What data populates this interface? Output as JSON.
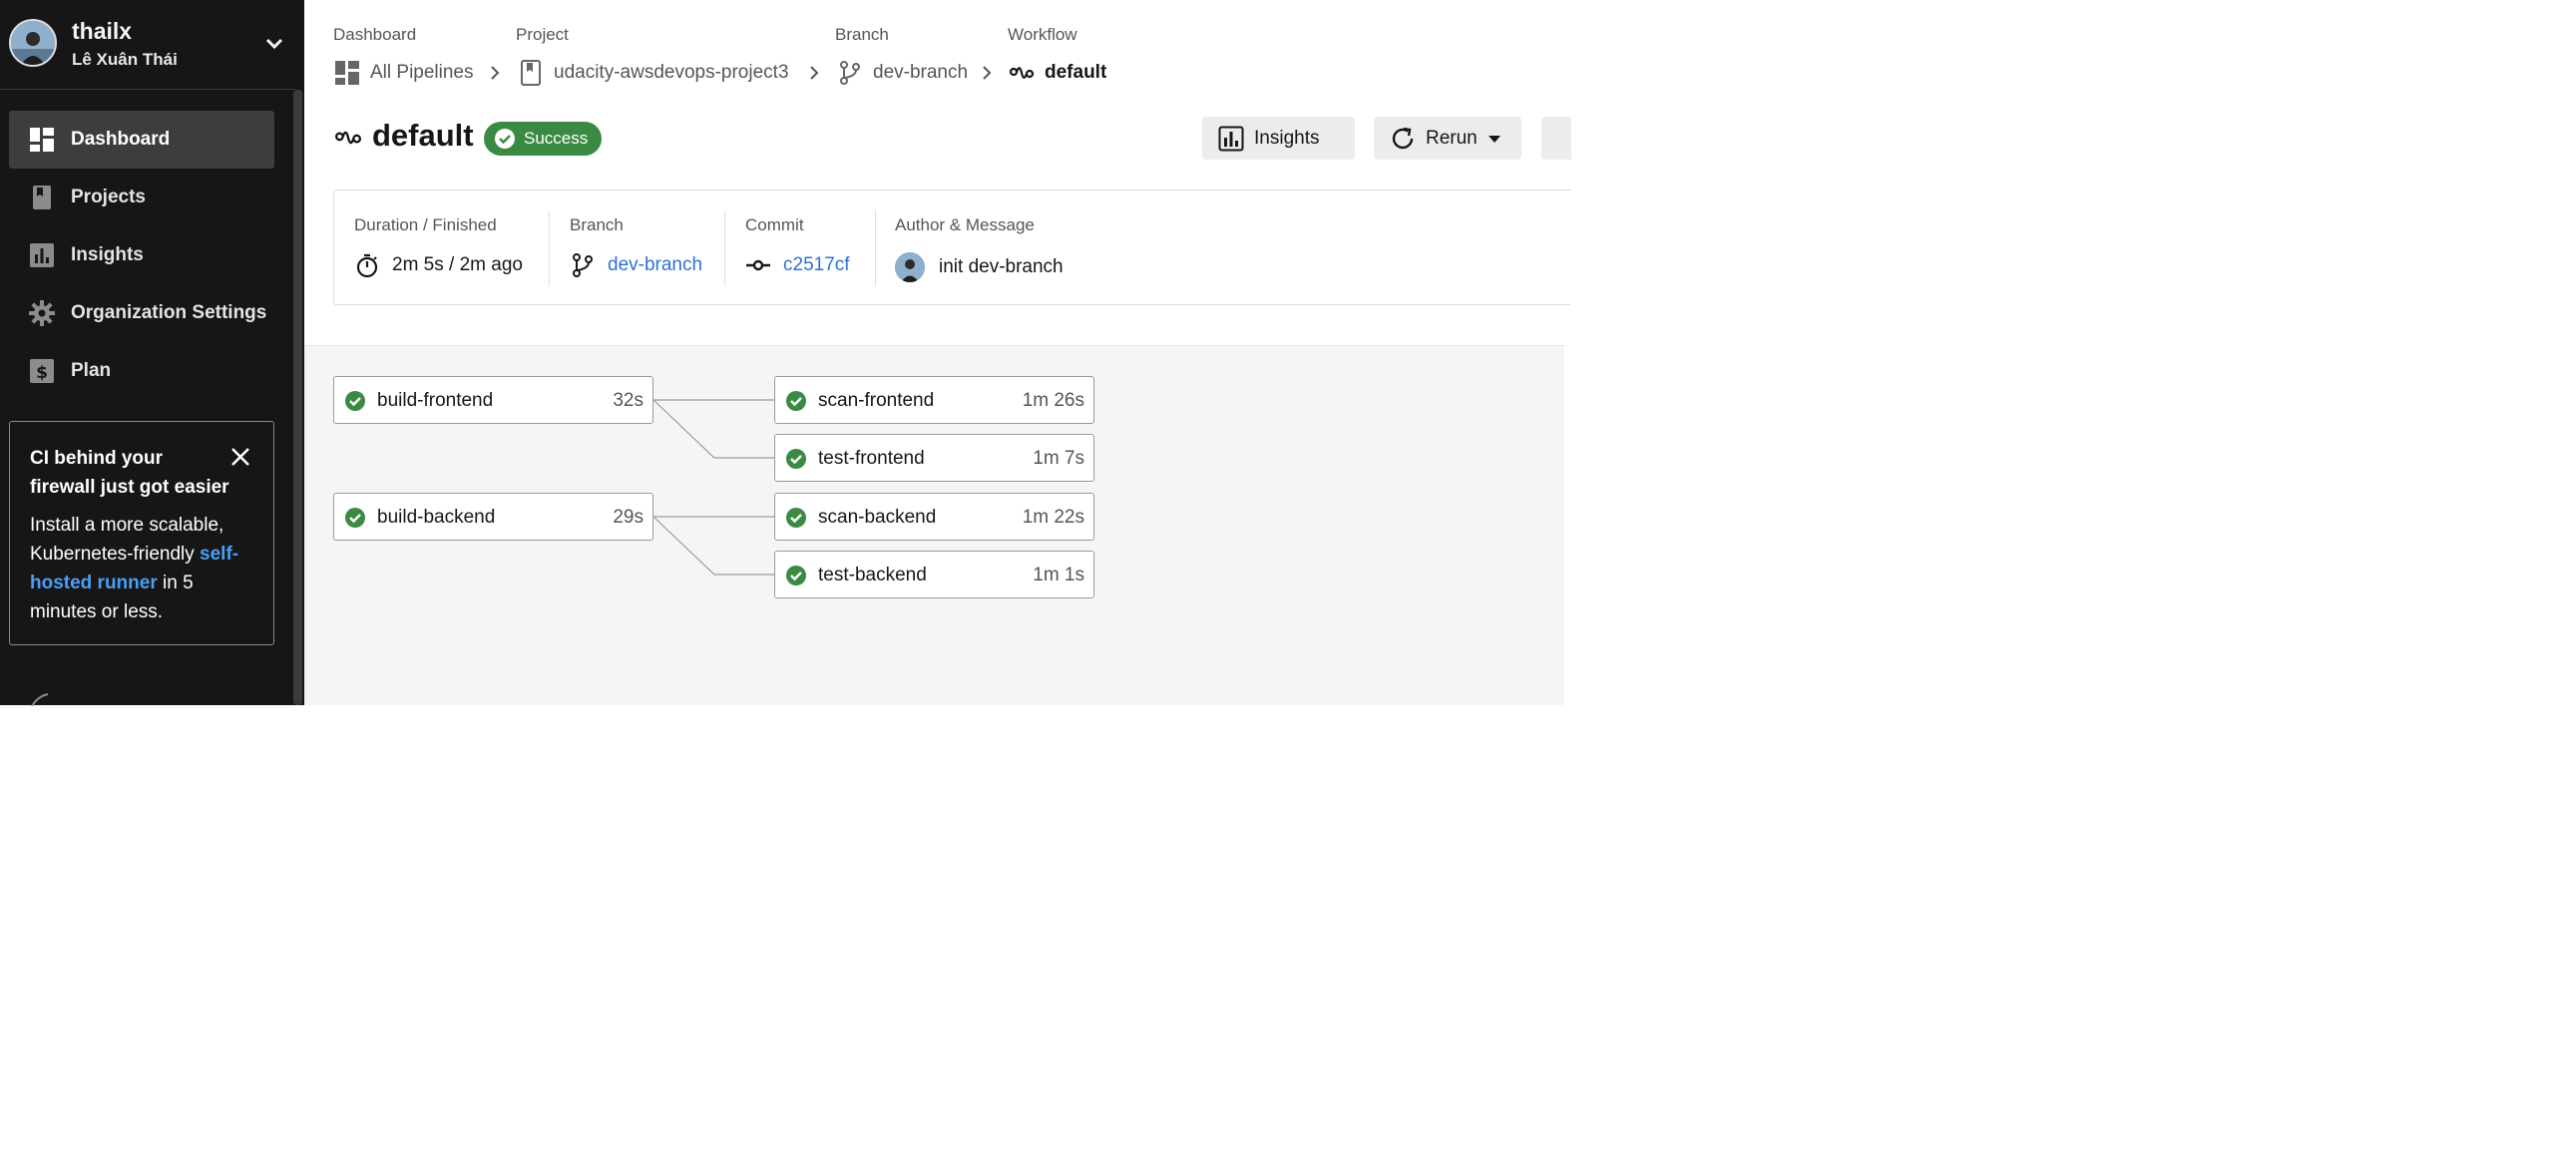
{
  "user": {
    "username": "thailx",
    "full_name": "Lê Xuân Thái"
  },
  "sidebar": {
    "items": [
      {
        "label": "Dashboard",
        "icon": "dashboard-icon",
        "active": true
      },
      {
        "label": "Projects",
        "icon": "projects-icon",
        "active": false
      },
      {
        "label": "Insights",
        "icon": "insights-icon",
        "active": false
      },
      {
        "label": "Organization Settings",
        "icon": "gear-icon",
        "active": false
      },
      {
        "label": "Plan",
        "icon": "dollar-icon",
        "active": false
      }
    ],
    "promo": {
      "title": "CI behind your firewall just got easier",
      "body_before": "Install a more scalable, Kubernetes-friendly ",
      "link": "self-hosted runner",
      "body_after": " in 5 minutes or less."
    }
  },
  "breadcrumb": {
    "labels": [
      "Dashboard",
      "Project",
      "Branch",
      "Workflow"
    ],
    "values": [
      "All Pipelines",
      "udacity-awsdevops-project3",
      "dev-branch",
      "default"
    ]
  },
  "workflow": {
    "name": "default",
    "status": "Success",
    "buttons": {
      "insights": "Insights",
      "rerun": "Rerun"
    }
  },
  "meta": {
    "duration_label": "Duration / Finished",
    "duration_value": "2m 5s / 2m ago",
    "branch_label": "Branch",
    "branch_value": "dev-branch",
    "commit_label": "Commit",
    "commit_value": "c2517cf",
    "author_label": "Author & Message",
    "author_value": "init dev-branch"
  },
  "jobs": [
    {
      "name": "build-frontend",
      "duration": "32s",
      "status": "success"
    },
    {
      "name": "scan-frontend",
      "duration": "1m 26s",
      "status": "success"
    },
    {
      "name": "test-frontend",
      "duration": "1m 7s",
      "status": "success"
    },
    {
      "name": "build-backend",
      "duration": "29s",
      "status": "success"
    },
    {
      "name": "scan-backend",
      "duration": "1m 22s",
      "status": "success"
    },
    {
      "name": "test-backend",
      "duration": "1m 1s",
      "status": "success"
    }
  ],
  "colors": {
    "success": "#3a8a43",
    "link": "#2f6fd6",
    "sidebar_bg": "#161616"
  }
}
